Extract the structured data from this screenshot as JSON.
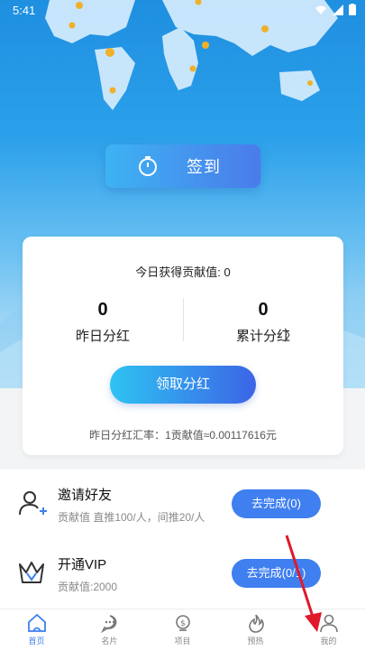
{
  "status": {
    "time": "5:41"
  },
  "signin": {
    "label": "签到"
  },
  "card": {
    "today": "今日获得贡献值: 0",
    "yesterday_value": "0",
    "yesterday_label": "昨日分红",
    "total_value": "0",
    "total_label": "累计分红",
    "chevron": "〉",
    "claim_label": "领取分红",
    "rate": "昨日分红汇率：1贡献值≈0.00117616元"
  },
  "tasks": [
    {
      "title": "邀请好友",
      "sub": "贡献值 直推100/人，间推20/人",
      "button": "去完成(0)",
      "icon": "user-add-icon"
    },
    {
      "title": "开通VIP",
      "sub": "贡献值:2000",
      "button": "去完成(0/1)",
      "icon": "crown-icon"
    }
  ],
  "nav": [
    {
      "label": "首页",
      "icon": "home-icon",
      "active": true
    },
    {
      "label": "名片",
      "icon": "chat-icon",
      "active": false
    },
    {
      "label": "项目",
      "icon": "coin-bulb-icon",
      "active": false
    },
    {
      "label": "预热",
      "icon": "fire-icon",
      "active": false
    },
    {
      "label": "我的",
      "icon": "profile-icon",
      "active": false
    }
  ],
  "colors": {
    "accent": "#3f7ff0",
    "hero": "#2aa0ea",
    "annotation_arrow": "#e0192b"
  }
}
